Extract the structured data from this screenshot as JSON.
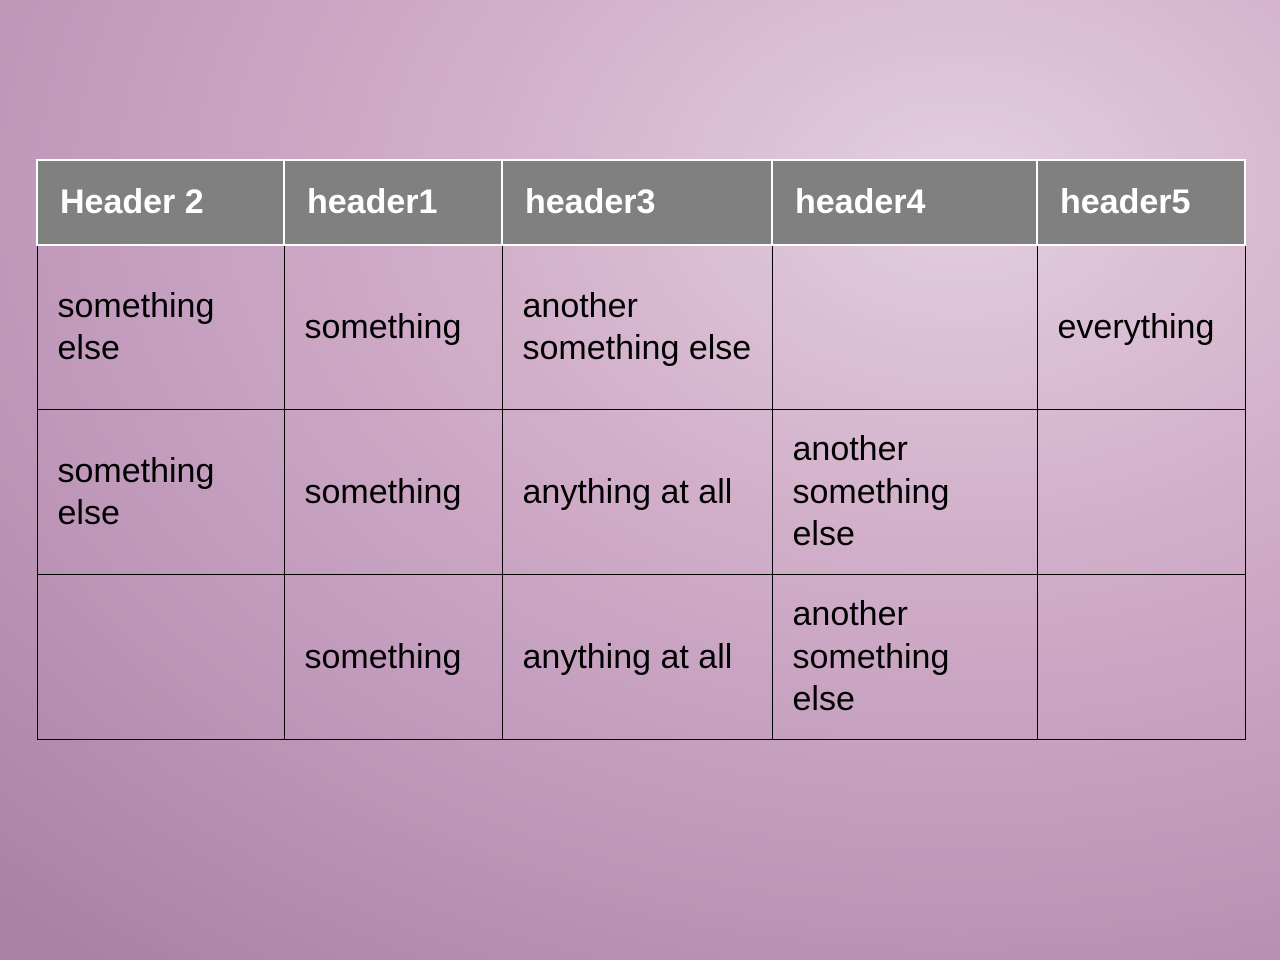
{
  "table": {
    "headers": [
      "Header 2",
      "header1",
      "header3",
      "header4",
      "header5"
    ],
    "rows": [
      [
        "something else",
        "something",
        "another something else",
        "",
        "everything"
      ],
      [
        "something else",
        "something",
        "anything at all",
        "another something else",
        ""
      ],
      [
        "",
        "something",
        "anything at all",
        "another something else",
        ""
      ]
    ]
  }
}
